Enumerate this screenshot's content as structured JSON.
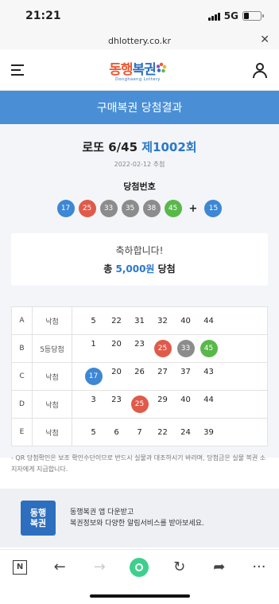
{
  "status_bar": {
    "time": "21:21",
    "network": "5G"
  },
  "browser": {
    "url": "dhlottery.co.kr"
  },
  "header": {
    "logo_text_1": "동행",
    "logo_text_2": "복권",
    "logo_sub": "Donghaeng Lottery"
  },
  "page_title": "구매복권 당첨결과",
  "game": {
    "name": "로또 6/45",
    "round": "제1002회",
    "draw_date": "2022-02-12 추첨"
  },
  "winning": {
    "label": "당첨번호",
    "numbers": [
      {
        "n": "17",
        "color": "#3d87d4"
      },
      {
        "n": "25",
        "color": "#e05a4a"
      },
      {
        "n": "33",
        "color": "#8c8c8c"
      },
      {
        "n": "35",
        "color": "#8c8c8c"
      },
      {
        "n": "38",
        "color": "#8c8c8c"
      },
      {
        "n": "45",
        "color": "#59b84a"
      }
    ],
    "plus": "+",
    "bonus": {
      "n": "15",
      "color": "#3d87d4"
    }
  },
  "prize": {
    "message": "축하합니다!",
    "prefix": "총 ",
    "amount": "5,000원",
    "suffix": " 당첨"
  },
  "tickets": [
    {
      "letter": "A",
      "result": "낙첨",
      "numbers": [
        {
          "n": "5"
        },
        {
          "n": "22"
        },
        {
          "n": "31"
        },
        {
          "n": "32"
        },
        {
          "n": "40"
        },
        {
          "n": "44"
        }
      ]
    },
    {
      "letter": "B",
      "result": "5등당첨",
      "numbers": [
        {
          "n": "1"
        },
        {
          "n": "20"
        },
        {
          "n": "23"
        },
        {
          "n": "25",
          "color": "#e05a4a"
        },
        {
          "n": "33",
          "color": "#8c8c8c"
        },
        {
          "n": "45",
          "color": "#59b84a"
        }
      ]
    },
    {
      "letter": "C",
      "result": "낙첨",
      "numbers": [
        {
          "n": "17",
          "color": "#3d87d4"
        },
        {
          "n": "20"
        },
        {
          "n": "26"
        },
        {
          "n": "27"
        },
        {
          "n": "37"
        },
        {
          "n": "43"
        }
      ]
    },
    {
      "letter": "D",
      "result": "낙첨",
      "numbers": [
        {
          "n": "3"
        },
        {
          "n": "23"
        },
        {
          "n": "25",
          "color": "#e05a4a"
        },
        {
          "n": "29"
        },
        {
          "n": "40"
        },
        {
          "n": "44"
        }
      ]
    },
    {
      "letter": "E",
      "result": "낙첨",
      "numbers": [
        {
          "n": "5"
        },
        {
          "n": "6"
        },
        {
          "n": "7"
        },
        {
          "n": "22"
        },
        {
          "n": "24"
        },
        {
          "n": "39"
        }
      ]
    }
  ],
  "notice": "- QR 당첨확인은 보조 확인수단이므로 반드시 실물과 대조하시기 바라며, 당첨금은 실물 복권 소지자에게 지급합니다.",
  "app_banner": {
    "logo": "동행\n복권",
    "line1": "동행복권 앱 다운받고",
    "line2": "복권정보와 다양한 알림서비스를 받아보세요."
  },
  "toolbar": {
    "n_label": "N",
    "back": "←",
    "forward": "→",
    "refresh": "↻",
    "share": "➦",
    "more": "···"
  }
}
